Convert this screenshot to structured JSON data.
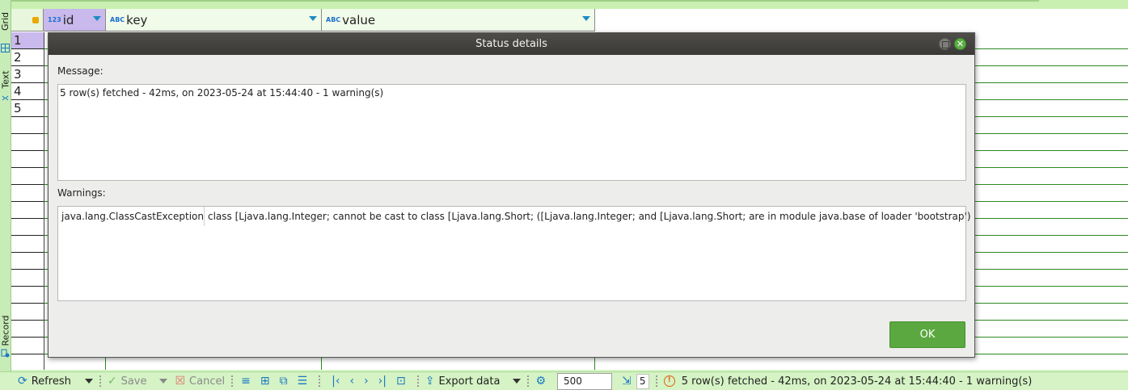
{
  "side_tabs": {
    "grid": "Grid",
    "text": "Text",
    "record": "Record"
  },
  "grid": {
    "columns": [
      {
        "type": "123",
        "name": "id"
      },
      {
        "type": "ABC",
        "name": "key"
      },
      {
        "type": "ABC",
        "name": "value"
      }
    ],
    "row_numbers": [
      "1",
      "2",
      "3",
      "4",
      "5"
    ]
  },
  "dialog": {
    "title": "Status details",
    "message_label": "Message:",
    "message": "5 row(s) fetched - 42ms, on 2023-05-24 at 15:44:40 - 1 warning(s)",
    "warnings_label": "Warnings:",
    "warnings": [
      {
        "type": "java.lang.ClassCastException",
        "text": "class [Ljava.lang.Integer; cannot be cast to class [Ljava.lang.Short; ([Ljava.lang.Integer; and [Ljava.lang.Short; are in module java.base of loader 'bootstrap')"
      }
    ],
    "ok_label": "OK"
  },
  "toolbar": {
    "refresh_label": "Refresh",
    "save_label": "Save",
    "cancel_label": "Cancel",
    "export_label": "Export data",
    "fetch_size": "500",
    "row_count": "5",
    "status_text": "5 row(s) fetched - 42ms, on 2023-05-24 at 15:44:40 - 1 warning(s)"
  },
  "colors": {
    "accent_green": "#5aa83f",
    "selected_purple": "#c9b9ec",
    "icon_blue": "#1b78c4",
    "warning_orange": "#e06010"
  }
}
